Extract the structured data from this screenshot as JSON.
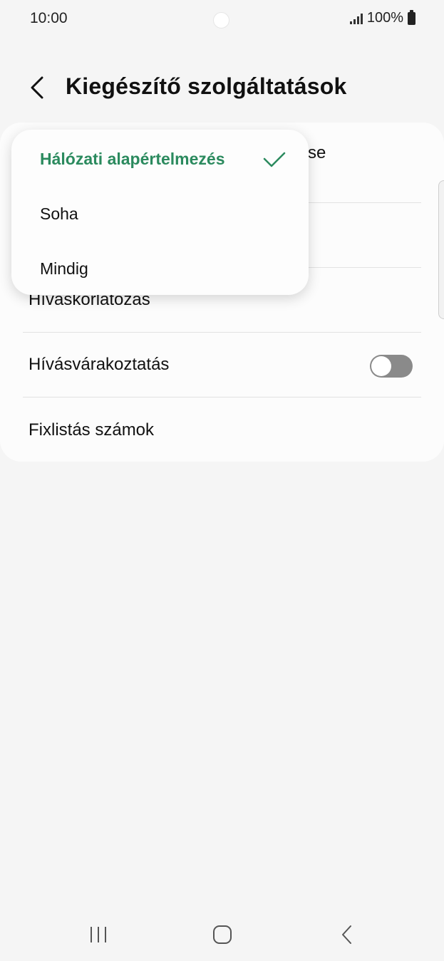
{
  "status": {
    "time": "10:00",
    "battery": "100%"
  },
  "header": {
    "title": "Kiegészítő szolgáltatások"
  },
  "settings": {
    "partial_behind_popup": "se",
    "rows": [
      {
        "label": "Hívaskorlatozas"
      },
      {
        "label": "Hívásvárakoztatás",
        "toggle_on": false
      },
      {
        "label": "Fixlistás számok"
      }
    ]
  },
  "popup": {
    "options": [
      {
        "label": "Hálózati alapértelmezés",
        "selected": true
      },
      {
        "label": "Soha",
        "selected": false
      },
      {
        "label": "Mindig",
        "selected": false
      }
    ]
  },
  "colors": {
    "accent": "#2b8a5e",
    "background": "#f5f5f5",
    "toggle_off": "#8a8a8a"
  },
  "icons": {
    "back": "back-arrow-icon",
    "check": "checkmark-icon",
    "nav_recent": "recent-apps-icon",
    "nav_home": "home-icon",
    "nav_back": "back-icon"
  }
}
